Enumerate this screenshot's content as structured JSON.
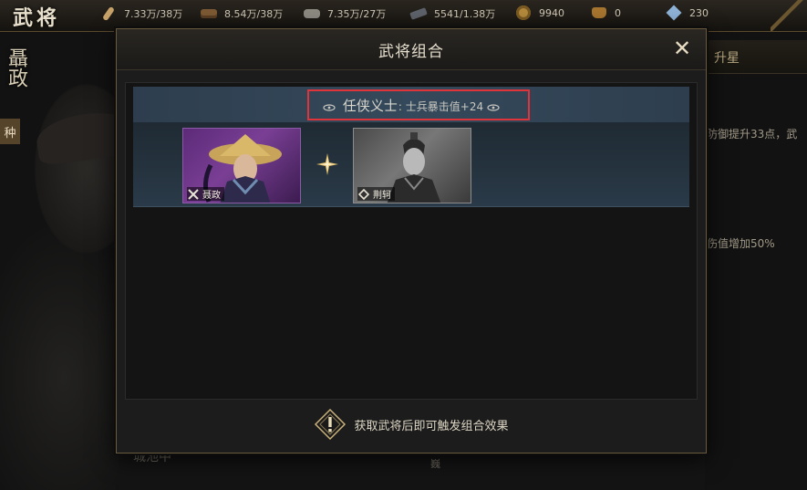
{
  "topbar": {
    "game_title": "武将",
    "resources": [
      {
        "icon": "feather-icon",
        "value": "7.33万/38万"
      },
      {
        "icon": "wood-icon",
        "value": "8.54万/38万"
      },
      {
        "icon": "stone-icon",
        "value": "7.35万/27万"
      },
      {
        "icon": "iron-icon",
        "value": "5541/1.38万"
      },
      {
        "icon": "coin-icon",
        "value": "9940"
      },
      {
        "icon": "gold-ingot-icon",
        "value": "0"
      },
      {
        "icon": "gem-icon",
        "value": "230"
      }
    ]
  },
  "background": {
    "hero_vertical_name": "聶政",
    "hero_tag": "种",
    "right_tab_label": "升星",
    "right_text_1": "防御提升33点，武",
    "right_text_2": "伤值增加50%",
    "bottom_left_text": "城池中",
    "bottom_center_text": "巍"
  },
  "modal": {
    "title": "武将组合",
    "close_symbol": "✕",
    "combo": {
      "name": "任侠义士",
      "separator": ":",
      "effect": "士兵暴击值+24"
    },
    "heroes": [
      {
        "name": "聂政",
        "rarity": "purple",
        "class_icon": "crossed-swords-icon"
      },
      {
        "name": "荆轲",
        "rarity": "gray",
        "class_icon": "diamond-icon"
      }
    ],
    "footer_text": "获取武将后即可触发组合效果"
  },
  "colors": {
    "highlight": "#e0343a",
    "combo_bar": "#34495b",
    "purple_card": "#7a3f95",
    "gold_accent": "#d9b45a"
  }
}
